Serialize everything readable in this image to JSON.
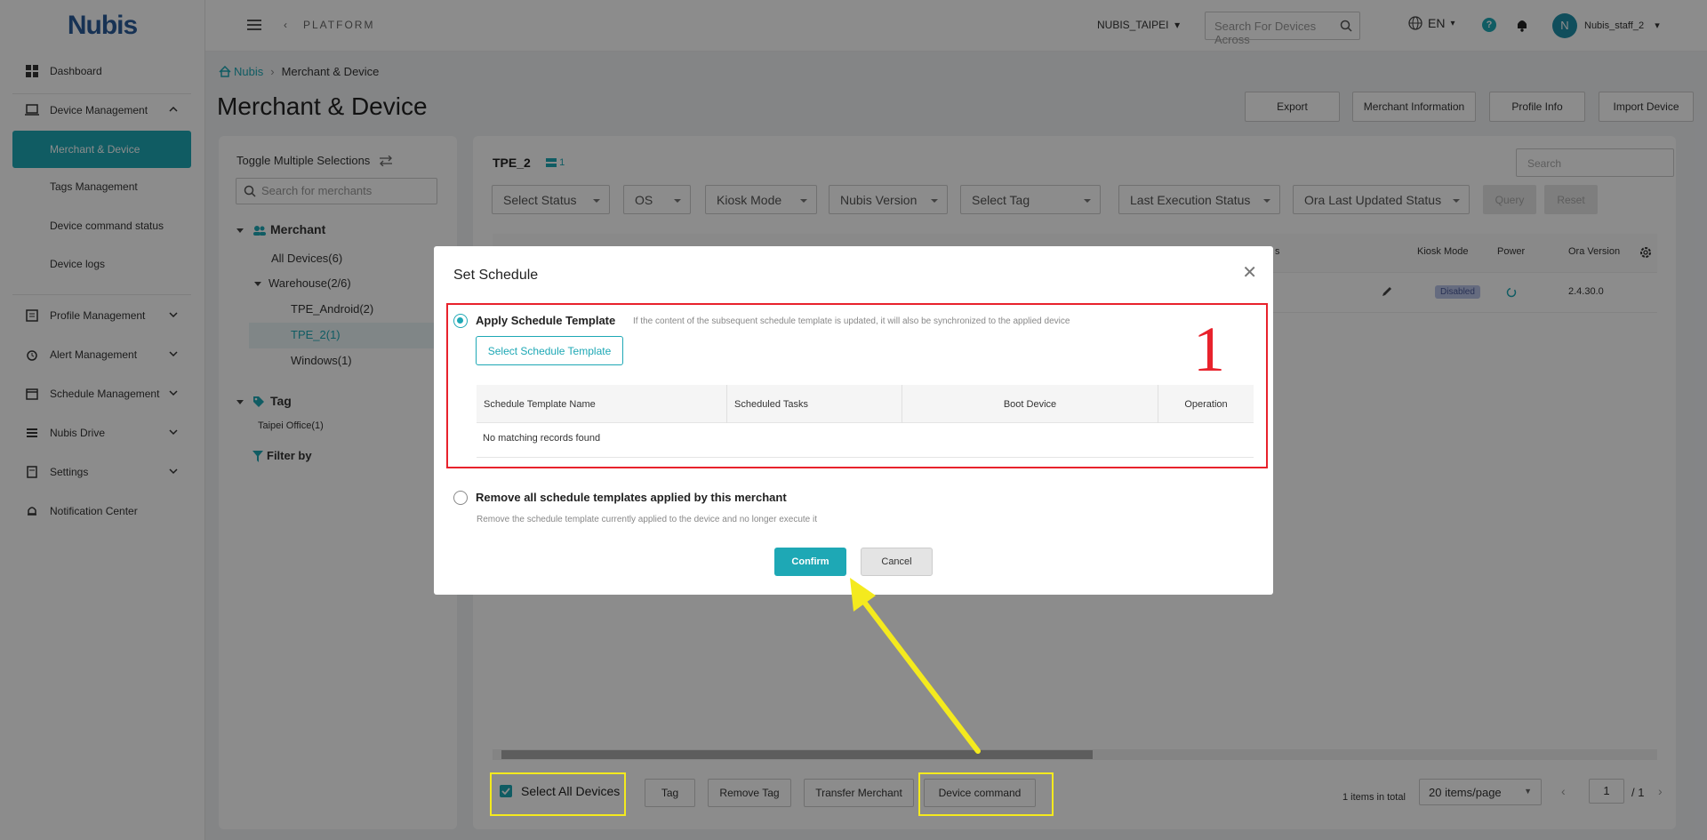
{
  "app": {
    "logo": "Nubis",
    "platform_label": "PLATFORM",
    "tenant": "NUBIS_TAIPEI",
    "search_placeholder": "Search For Devices Across",
    "lang": "EN",
    "help_glyph": "?",
    "avatar_initial": "N",
    "user": "Nubis_staff_2"
  },
  "sidebar": {
    "items": [
      {
        "label": "Dashboard"
      },
      {
        "label": "Device Management"
      },
      {
        "label": "Merchant & Device"
      },
      {
        "label": "Tags Management"
      },
      {
        "label": "Device command status"
      },
      {
        "label": "Device logs"
      },
      {
        "label": "Profile Management"
      },
      {
        "label": "Alert Management"
      },
      {
        "label": "Schedule Management"
      },
      {
        "label": "Nubis Drive"
      },
      {
        "label": "Settings"
      },
      {
        "label": "Notification Center"
      }
    ]
  },
  "page": {
    "breadcrumb_home": "Nubis",
    "breadcrumb_sep": "›",
    "breadcrumb_current": "Merchant & Device",
    "title": "Merchant & Device",
    "actions": [
      "Export",
      "Merchant Information",
      "Profile Info",
      "Import Device"
    ]
  },
  "merchants": {
    "toggle_label": "Toggle Multiple Selections",
    "search_placeholder": "Search for merchants",
    "merchant_header": "Merchant",
    "nodes": [
      "All Devices(6)",
      "Warehouse(2/6)",
      "TPE_Android(2)",
      "TPE_2(1)",
      "Windows(1)"
    ],
    "tag_header": "Tag",
    "tags": [
      "Taipei Office(1)"
    ],
    "filter_by": "Filter by"
  },
  "devices": {
    "group_name": "TPE_2",
    "group_count": "1",
    "search_placeholder": "Search",
    "filters": [
      "Select Status",
      "OS",
      "Kiosk Mode",
      "Nubis Version",
      "Select Tag",
      "Last Execution Status",
      "Ora Last Updated Status"
    ],
    "query": "Query",
    "reset": "Reset",
    "columns": [
      "s",
      "Kiosk Mode",
      "Power",
      "Ora Version"
    ],
    "row": {
      "kiosk": "Disabled",
      "ora_version": "2.4.30.0"
    },
    "select_all": "Select All Devices",
    "bottom_actions": [
      "Tag",
      "Remove Tag",
      "Transfer Merchant",
      "Device command"
    ],
    "total": "1 items in total",
    "per_page": "20 items/page",
    "page": "1",
    "page_total": "/ 1"
  },
  "modal": {
    "title": "Set Schedule",
    "close_glyph": "✕",
    "option1": {
      "label": "Apply Schedule Template",
      "desc": "If the content of the subsequent schedule template is updated, it will also be synchronized to the applied device",
      "button": "Select Schedule Template",
      "columns": [
        "Schedule Template Name",
        "Scheduled Tasks",
        "Boot Device",
        "Operation"
      ],
      "empty": "No matching records found"
    },
    "option2": {
      "label": "Remove all schedule templates applied by this merchant",
      "desc": "Remove the schedule template currently applied to the device and no longer execute it"
    },
    "confirm": "Confirm",
    "cancel": "Cancel",
    "annotation": "1"
  }
}
